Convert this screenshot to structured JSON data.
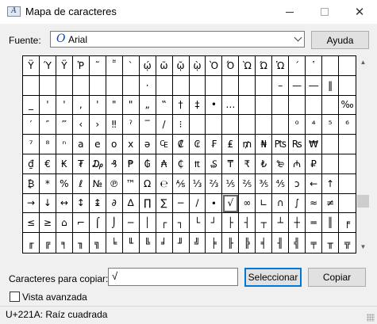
{
  "window": {
    "title": "Mapa de caracteres",
    "close_glyph": "✕"
  },
  "font": {
    "label": "Fuente:",
    "selected": "Arial",
    "icon": "opentype-font-icon"
  },
  "help_button": "Ayuda",
  "grid": {
    "rows": [
      [
        "Ÿ",
        "Ύ",
        "Ϋ",
        "Ῥ",
        "῀",
        "῁",
        "`",
        "ῴ",
        "ῶ",
        "ῷ",
        "ῲ",
        "Ὸ",
        "Ό",
        "Ὼ",
        "Ώ",
        "Ὡ",
        "´",
        "῾",
        "",
        ""
      ],
      [
        "",
        "",
        "",
        "",
        "",
        "",
        "",
        "·",
        "",
        "",
        "",
        "",
        "",
        "",
        "",
        "–",
        "—",
        "―",
        "‖",
        ""
      ],
      [
        "_",
        "'",
        "'",
        ",",
        "'",
        "\"",
        "\"",
        "„",
        "‟",
        "†",
        "‡",
        "•",
        "…",
        "",
        "",
        "",
        "",
        "",
        "",
        "‰"
      ],
      [
        "′",
        "″",
        "‴",
        "‹",
        "›",
        "‼",
        "ˀ",
        "‾",
        "/",
        "⁝",
        "",
        "",
        "",
        "",
        "",
        "",
        "⁰",
        "⁴",
        "⁵",
        "⁶"
      ],
      [
        "⁷",
        "⁸",
        "ⁿ",
        "a",
        "e",
        "o",
        "x",
        "ə",
        "₠",
        "₡",
        "₢",
        "₣",
        "₤",
        "₥",
        "₦",
        "₧",
        "₨",
        "₩",
        ""
      ],
      [
        "₫",
        "€",
        "₭",
        "₮",
        "₯",
        "₰",
        "₱",
        "₲",
        "₳",
        "₵",
        "₶",
        "₷",
        "₸",
        "₹",
        "₺",
        "₻",
        "₼",
        "₽",
        "",
        ""
      ],
      [
        "₿",
        "*",
        "%",
        "ℓ",
        "№",
        "℗",
        "™",
        "Ω",
        "℮",
        "⅍",
        "⅓",
        "⅔",
        "⅕",
        "⅖",
        "⅗",
        "⅘",
        "ↄ",
        "←",
        "↑",
        ""
      ],
      [
        "→",
        "↓",
        "↔",
        "↕",
        "↨",
        "∂",
        "∆",
        "∏",
        "∑",
        "−",
        "∕",
        "∙",
        "√",
        "∞",
        "∟",
        "∩",
        "∫",
        "≈",
        "≠",
        ""
      ],
      [
        "≤",
        "≥",
        "⌂",
        "⌐",
        "⌠",
        "⌡",
        "─",
        "│",
        "┌",
        "┐",
        "└",
        "┘",
        "├",
        "┤",
        "┬",
        "┴",
        "┼",
        "═",
        "║",
        "╒"
      ],
      [
        "╓",
        "╔",
        "╕",
        "╖",
        "╗",
        "╘",
        "╙",
        "╚",
        "╛",
        "╜",
        "╝",
        "╞",
        "╟",
        "╠",
        "╡",
        "╢",
        "╣",
        "╤",
        "╥",
        "╦"
      ]
    ],
    "selected_char": "√"
  },
  "copy": {
    "label": "Caracteres para copiar:",
    "value": "√"
  },
  "select_button": "Seleccionar",
  "copy_button": "Copiar",
  "advanced_view": {
    "label": "Vista avanzada",
    "checked": false
  },
  "status": {
    "text": "U+221A: Raíz cuadrada"
  }
}
